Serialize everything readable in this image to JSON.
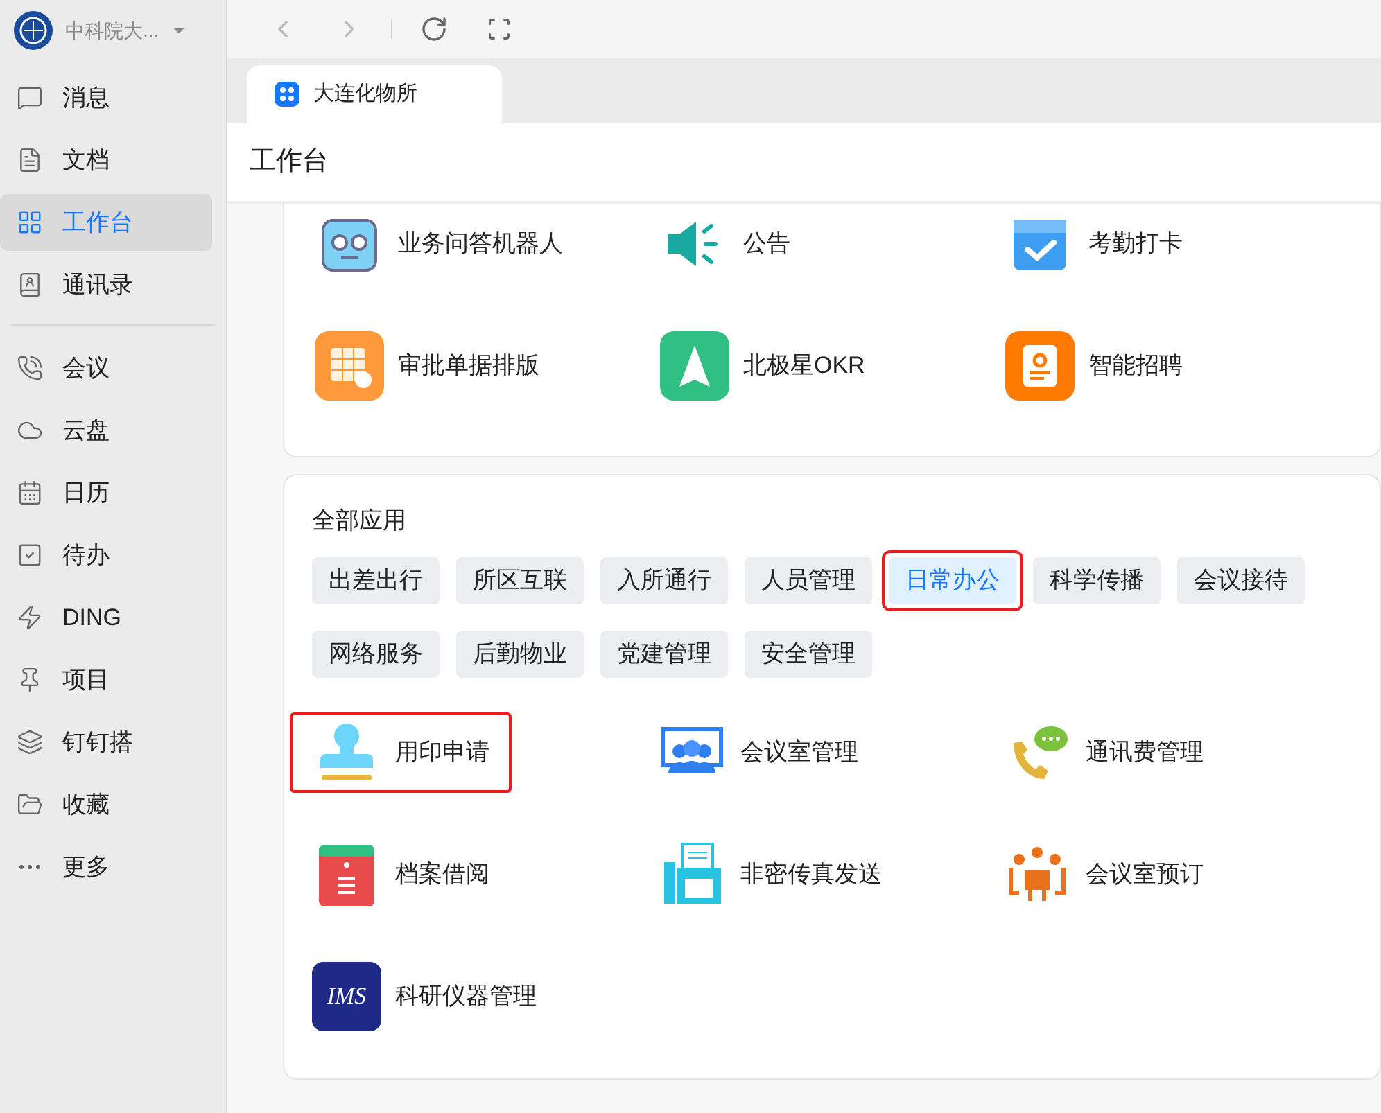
{
  "org": {
    "name": "中科院大..."
  },
  "sidebar": {
    "groups": [
      {
        "items": [
          {
            "label": "消息",
            "selected": false
          },
          {
            "label": "文档",
            "selected": false
          },
          {
            "label": "工作台",
            "selected": true
          },
          {
            "label": "通讯录",
            "selected": false
          }
        ]
      },
      {
        "items": [
          {
            "label": "会议",
            "selected": false
          },
          {
            "label": "云盘",
            "selected": false
          },
          {
            "label": "日历",
            "selected": false
          },
          {
            "label": "待办",
            "selected": false
          },
          {
            "label": "DING",
            "selected": false
          },
          {
            "label": "项目",
            "selected": false
          },
          {
            "label": "钉钉搭",
            "selected": false
          },
          {
            "label": "收藏",
            "selected": false
          },
          {
            "label": "更多",
            "selected": false
          }
        ]
      }
    ]
  },
  "tabs": [
    {
      "label": "大连化物所",
      "selected": true
    }
  ],
  "page_title": "工作台",
  "top_apps": [
    {
      "name": "业务问答机器人"
    },
    {
      "name": "公告"
    },
    {
      "name": "考勤打卡"
    },
    {
      "name": "审批单据排版"
    },
    {
      "name": "北极星OKR"
    },
    {
      "name": "智能招聘"
    }
  ],
  "all_apps": {
    "title": "全部应用",
    "categories": [
      {
        "label": "出差出行",
        "selected": false,
        "highlighted": false
      },
      {
        "label": "所区互联",
        "selected": false,
        "highlighted": false
      },
      {
        "label": "入所通行",
        "selected": false,
        "highlighted": false
      },
      {
        "label": "人员管理",
        "selected": false,
        "highlighted": false
      },
      {
        "label": "日常办公",
        "selected": true,
        "highlighted": true
      },
      {
        "label": "科学传播",
        "selected": false,
        "highlighted": false
      },
      {
        "label": "会议接待",
        "selected": false,
        "highlighted": false
      },
      {
        "label": "网络服务",
        "selected": false,
        "highlighted": false
      },
      {
        "label": "后勤物业",
        "selected": false,
        "highlighted": false
      },
      {
        "label": "党建管理",
        "selected": false,
        "highlighted": false
      },
      {
        "label": "安全管理",
        "selected": false,
        "highlighted": false
      }
    ],
    "apps": [
      {
        "name": "用印申请",
        "highlighted": true
      },
      {
        "name": "会议室管理",
        "highlighted": false
      },
      {
        "name": "通讯费管理",
        "highlighted": false
      },
      {
        "name": "档案借阅",
        "highlighted": false
      },
      {
        "name": "非密传真发送",
        "highlighted": false
      },
      {
        "name": "会议室预订",
        "highlighted": false
      },
      {
        "name": "科研仪器管理",
        "highlighted": false,
        "logo_text": "IMS"
      }
    ]
  }
}
